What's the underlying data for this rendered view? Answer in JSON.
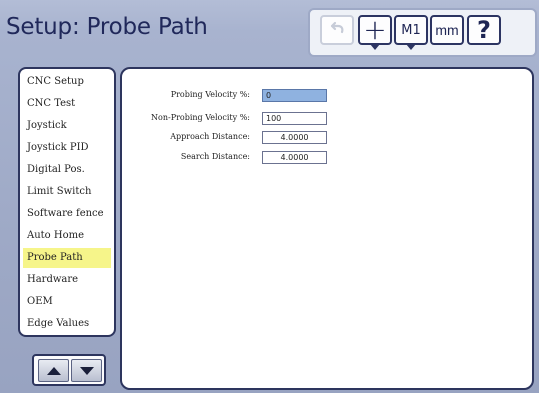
{
  "title": "Setup: Probe Path",
  "toolbar": {
    "undo_icon": "undo-icon",
    "plus_symbol": "+",
    "m1_label": "M1",
    "mm_label": "mm",
    "help_symbol": "?"
  },
  "menu": {
    "items": [
      {
        "label": "CNC Setup",
        "selected": false
      },
      {
        "label": "CNC Test",
        "selected": false
      },
      {
        "label": "Joystick",
        "selected": false
      },
      {
        "label": "Joystick PID",
        "selected": false
      },
      {
        "label": "Digital Pos.",
        "selected": false
      },
      {
        "label": "Limit Switch",
        "selected": false
      },
      {
        "label": "Software fence",
        "selected": false
      },
      {
        "label": "Auto Home",
        "selected": false
      },
      {
        "label": "Probe Path",
        "selected": true
      },
      {
        "label": "Hardware",
        "selected": false
      },
      {
        "label": "OEM",
        "selected": false
      },
      {
        "label": "Edge Values",
        "selected": false
      }
    ],
    "highlight_color": "#f6f58a"
  },
  "nav": {
    "up_icon": "arrow-up-icon",
    "down_icon": "arrow-down-icon"
  },
  "form": {
    "fields": [
      {
        "label": "Probing Velocity %:",
        "value": "0",
        "active": true
      },
      {
        "label": "Non-Probing Velocity %:",
        "value": "100",
        "active": false
      },
      {
        "label": "Approach Distance:",
        "value": "4.0000",
        "active": false
      },
      {
        "label": "Search Distance:",
        "value": "4.0000",
        "active": false
      }
    ]
  },
  "colors": {
    "background": "#9ea9c6",
    "panel_border": "#2d355e",
    "active_field": "#8fb2e0"
  }
}
